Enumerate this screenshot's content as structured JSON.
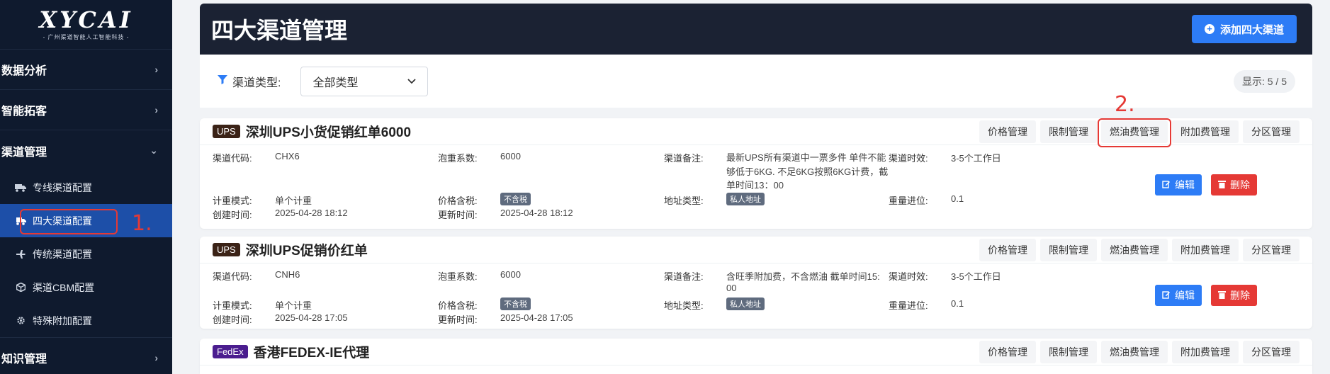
{
  "sidebar": {
    "logo": "XYCAI",
    "logo_sub": "- 广州渠道智能人工智能科技 -",
    "groups": [
      {
        "label": "数据分析"
      },
      {
        "label": "智能拓客"
      },
      {
        "label": "渠道管理"
      },
      {
        "label": "知识管理"
      }
    ],
    "subitems": [
      {
        "label": "专线渠道配置",
        "icon": "truck-icon"
      },
      {
        "label": "四大渠道配置",
        "icon": "truck-fast-icon"
      },
      {
        "label": "传统渠道配置",
        "icon": "plane-icon"
      },
      {
        "label": "渠道CBM配置",
        "icon": "box-icon"
      },
      {
        "label": "特殊附加配置",
        "icon": "gear-icon"
      }
    ]
  },
  "annotations": {
    "one": "1.",
    "two": "2."
  },
  "header": {
    "title": "四大渠道管理",
    "add_button": "添加四大渠道"
  },
  "filter": {
    "label": "渠道类型:",
    "value": "全部类型",
    "count": "显示: 5 / 5"
  },
  "tabs": [
    "价格管理",
    "限制管理",
    "燃油费管理",
    "附加费管理",
    "分区管理"
  ],
  "labels": {
    "code": "渠道代码:",
    "bubble": "泡重系数:",
    "remark": "渠道备注:",
    "timing": "渠道时效:",
    "mode": "计重模式:",
    "tax": "价格含税:",
    "addr": "地址类型:",
    "weight": "重量进位:",
    "created": "创建时间:",
    "updated": "更新时间:"
  },
  "buttons": {
    "edit": "编辑",
    "delete": "删除"
  },
  "cards": [
    {
      "carrier": "UPS",
      "badge_color": "#4a2a1a",
      "title": "深圳UPS小货促销红单6000",
      "code": "CHX6",
      "bubble": "6000",
      "remark_lines": [
        "最新UPS所有渠道中一票多件 单件不能",
        "够低于6KG. 不足6KG按照6KG计费，截",
        "单时间13：00"
      ],
      "timing": "3-5个工作日",
      "mode": "单个计重",
      "tax": "不含税",
      "addr": "私人地址",
      "weight": "0.1",
      "created": "2025-04-28 18:12",
      "updated": "2025-04-28 18:12"
    },
    {
      "carrier": "UPS",
      "badge_color": "#4a2a1a",
      "title": "深圳UPS促销价红单",
      "code": "CNH6",
      "bubble": "6000",
      "remark_lines": [
        "含旺季附加费，不含燃油 截单时间15:",
        "00"
      ],
      "timing": "3-5个工作日",
      "mode": "单个计重",
      "tax": "不含税",
      "addr": "私人地址",
      "weight": "0.1",
      "created": "2025-04-28 17:05",
      "updated": "2025-04-28 17:05"
    },
    {
      "carrier": "FedEx",
      "badge_color": "#4b1d8f",
      "title": "香港FEDEX-IE代理"
    }
  ]
}
